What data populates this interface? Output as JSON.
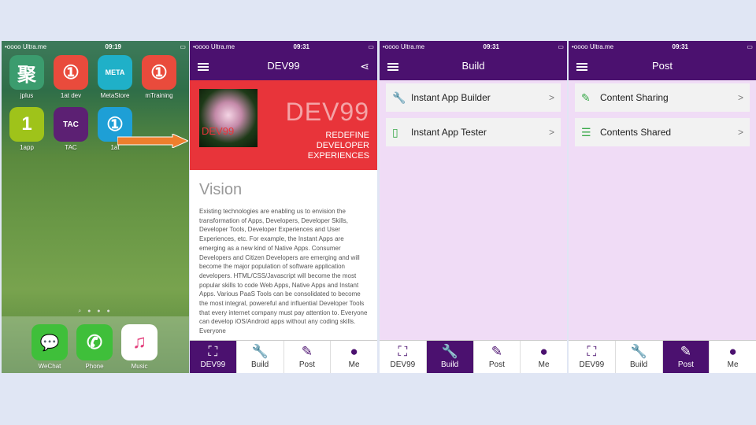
{
  "home": {
    "status": {
      "carrier": "•oooo Ultra.me",
      "time": "09:19"
    },
    "apps": [
      {
        "label": "jplus",
        "glyph": "聚",
        "color": "#3b9c6e"
      },
      {
        "label": "1at dev",
        "glyph": "①",
        "color": "#e94b3c"
      },
      {
        "label": "MetaStore",
        "glyph": "META",
        "color": "#1fb0c8"
      },
      {
        "label": "mTraining",
        "glyph": "①",
        "color": "#e94b3c"
      },
      {
        "label": "1app",
        "glyph": "1",
        "color": "#9fc31a"
      },
      {
        "label": "TAC",
        "glyph": "TAC",
        "color": "#5c2073"
      },
      {
        "label": "1at",
        "glyph": "①",
        "color": "#1e9fd6"
      }
    ],
    "dock": [
      {
        "label": "WeChat",
        "glyph": "💬",
        "color": "#3fbf3a"
      },
      {
        "label": "Phone",
        "glyph": "✆",
        "color": "#3fbf3a"
      },
      {
        "label": "Music",
        "glyph": "♫",
        "color": "#ffffff"
      }
    ]
  },
  "dev99": {
    "status": {
      "carrier": "•oooo Ultra.me",
      "time": "09:31"
    },
    "title": "DEV99",
    "hero_logo_text": "DEV99",
    "hero_big": "DEV99",
    "hero_sub": [
      "REDEFINE",
      "DEVELOPER",
      "EXPERIENCES"
    ],
    "vision_title": "Vision",
    "vision_body": "Existing technologies are enabling us to envision the transformation of Apps, Developers, Developer Skills, Developer Tools, Developer Experiences and User Experiences, etc. For example, the Instant Apps are emerging as a new kind of Native Apps. Consumer Developers and Citizen Developers are emerging and will become the major population of software application developers. HTML/CSS/Javascript will become the most popular skills to code Web Apps, Native Apps and Instant Apps. Various PaaS Tools can be consolidated to become the most integral, powereful and influential Developer Tools that every internet company must pay attention to. Everyone can develop iOS/Android apps without any coding skills. Everyone"
  },
  "build": {
    "status": {
      "carrier": "•oooo Ultra.me",
      "time": "09:31"
    },
    "title": "Build",
    "items": [
      {
        "label": "Instant App Builder",
        "icon": "wrench-icon"
      },
      {
        "label": "Instant App Tester",
        "icon": "phone-icon"
      }
    ]
  },
  "post": {
    "status": {
      "carrier": "•oooo Ultra.me",
      "time": "09:31"
    },
    "title": "Post",
    "items": [
      {
        "label": "Content Sharing",
        "icon": "edit-icon"
      },
      {
        "label": "Contents Shared",
        "icon": "list-icon"
      }
    ]
  },
  "tabs": [
    {
      "label": "DEV99"
    },
    {
      "label": "Build"
    },
    {
      "label": "Post"
    },
    {
      "label": "Me"
    }
  ],
  "colors": {
    "primary": "#4b116f",
    "hero": "#e8343a",
    "arrow": "#ee7f2d",
    "screen_bg": "#f0dcf6"
  }
}
